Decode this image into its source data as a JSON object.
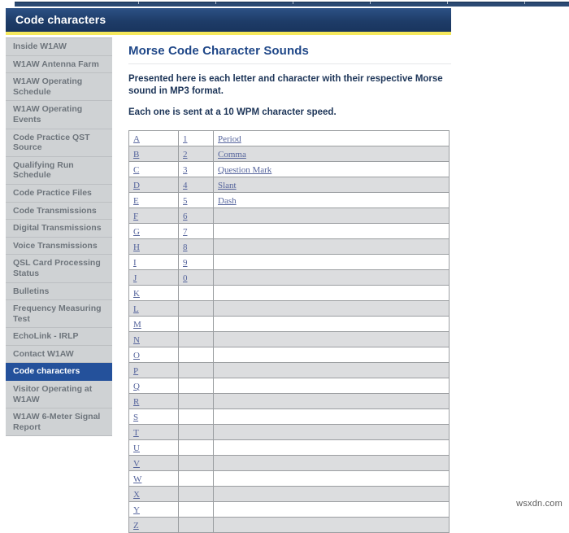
{
  "site": {
    "watermark": "wsxdn.com"
  },
  "header": {
    "title": "Code characters"
  },
  "sidebar": {
    "items": [
      {
        "label": "Inside W1AW",
        "active": false
      },
      {
        "label": "W1AW Antenna Farm",
        "active": false
      },
      {
        "label": "W1AW Operating Schedule",
        "active": false
      },
      {
        "label": "W1AW Operating Events",
        "active": false
      },
      {
        "label": "Code Practice QST Source",
        "active": false
      },
      {
        "label": "Qualifying Run Schedule",
        "active": false
      },
      {
        "label": "Code Practice Files",
        "active": false
      },
      {
        "label": "Code Transmissions",
        "active": false
      },
      {
        "label": "Digital Transmissions",
        "active": false
      },
      {
        "label": "Voice Transmissions",
        "active": false
      },
      {
        "label": "QSL Card Processing Status",
        "active": false
      },
      {
        "label": "Bulletins",
        "active": false
      },
      {
        "label": "Frequency Measuring Test",
        "active": false
      },
      {
        "label": "EchoLink - IRLP",
        "active": false
      },
      {
        "label": "Contact W1AW",
        "active": false
      },
      {
        "label": "Code characters",
        "active": true
      },
      {
        "label": "Visitor Operating at W1AW",
        "active": false
      },
      {
        "label": "W1AW 6-Meter Signal Report",
        "active": false
      }
    ]
  },
  "main": {
    "title": "Morse Code Character Sounds",
    "paragraphs": [
      "Presented here is each letter and character with their respective Morse sound in MP3 format.",
      "Each one is sent at a 10 WPM character speed."
    ],
    "table": {
      "rows": [
        {
          "letter": "A",
          "number": "1",
          "symbol": "Period"
        },
        {
          "letter": "B",
          "number": "2",
          "symbol": "Comma"
        },
        {
          "letter": "C",
          "number": "3",
          "symbol": "Question Mark"
        },
        {
          "letter": "D",
          "number": "4",
          "symbol": "Slant"
        },
        {
          "letter": "E",
          "number": "5",
          "symbol": "Dash"
        },
        {
          "letter": "F",
          "number": "6",
          "symbol": ""
        },
        {
          "letter": "G",
          "number": "7",
          "symbol": ""
        },
        {
          "letter": "H",
          "number": "8",
          "symbol": ""
        },
        {
          "letter": "I",
          "number": "9",
          "symbol": ""
        },
        {
          "letter": "J",
          "number": "0",
          "symbol": ""
        },
        {
          "letter": "K",
          "number": "",
          "symbol": ""
        },
        {
          "letter": "L",
          "number": "",
          "symbol": ""
        },
        {
          "letter": "M",
          "number": "",
          "symbol": ""
        },
        {
          "letter": "N",
          "number": "",
          "symbol": ""
        },
        {
          "letter": "O",
          "number": "",
          "symbol": ""
        },
        {
          "letter": "P",
          "number": "",
          "symbol": ""
        },
        {
          "letter": "Q",
          "number": "",
          "symbol": ""
        },
        {
          "letter": "R",
          "number": "",
          "symbol": ""
        },
        {
          "letter": "S",
          "number": "",
          "symbol": ""
        },
        {
          "letter": "T",
          "number": "",
          "symbol": ""
        },
        {
          "letter": "U",
          "number": "",
          "symbol": ""
        },
        {
          "letter": "V",
          "number": "",
          "symbol": ""
        },
        {
          "letter": "W",
          "number": "",
          "symbol": ""
        },
        {
          "letter": "X",
          "number": "",
          "symbol": ""
        },
        {
          "letter": "Y",
          "number": "",
          "symbol": ""
        },
        {
          "letter": "Z",
          "number": "",
          "symbol": ""
        }
      ]
    }
  },
  "colors": {
    "header_blue": "#1f3f6e",
    "accent_yellow": "#f5e85c",
    "sidebar_gray": "#cfd2d4",
    "active_blue": "#24519b",
    "title_blue": "#1f4788",
    "link_blue": "#55649c",
    "row_alt": "#dcdddf"
  }
}
